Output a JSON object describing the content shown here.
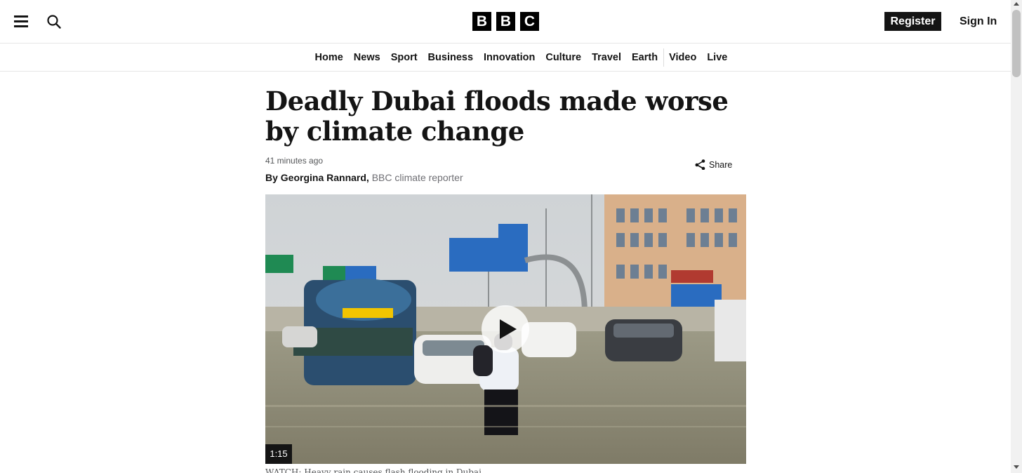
{
  "header": {
    "logo_letters": [
      "B",
      "B",
      "C"
    ],
    "register_label": "Register",
    "signin_label": "Sign In",
    "menu_icon": "hamburger-menu-icon",
    "search_icon": "search-icon"
  },
  "nav": {
    "items": [
      {
        "label": "Home"
      },
      {
        "label": "News"
      },
      {
        "label": "Sport"
      },
      {
        "label": "Business"
      },
      {
        "label": "Innovation"
      },
      {
        "label": "Culture"
      },
      {
        "label": "Travel"
      },
      {
        "label": "Earth"
      },
      {
        "label": "Video"
      },
      {
        "label": "Live"
      }
    ]
  },
  "article": {
    "headline": "Deadly Dubai floods made worse by climate change",
    "timestamp": "41 minutes ago",
    "author": "By Georgina Rannard,",
    "author_role": "BBC climate reporter",
    "share_label": "Share",
    "share_icon": "share-icon"
  },
  "media": {
    "duration": "1:15",
    "play_icon": "play-icon",
    "caption": "WATCH: Heavy rain causes flash flooding in Dubai"
  },
  "colors": {
    "text": "#141414",
    "secondary_text": "#545658",
    "register_bg": "#141414",
    "logo_bg": "#000000"
  }
}
